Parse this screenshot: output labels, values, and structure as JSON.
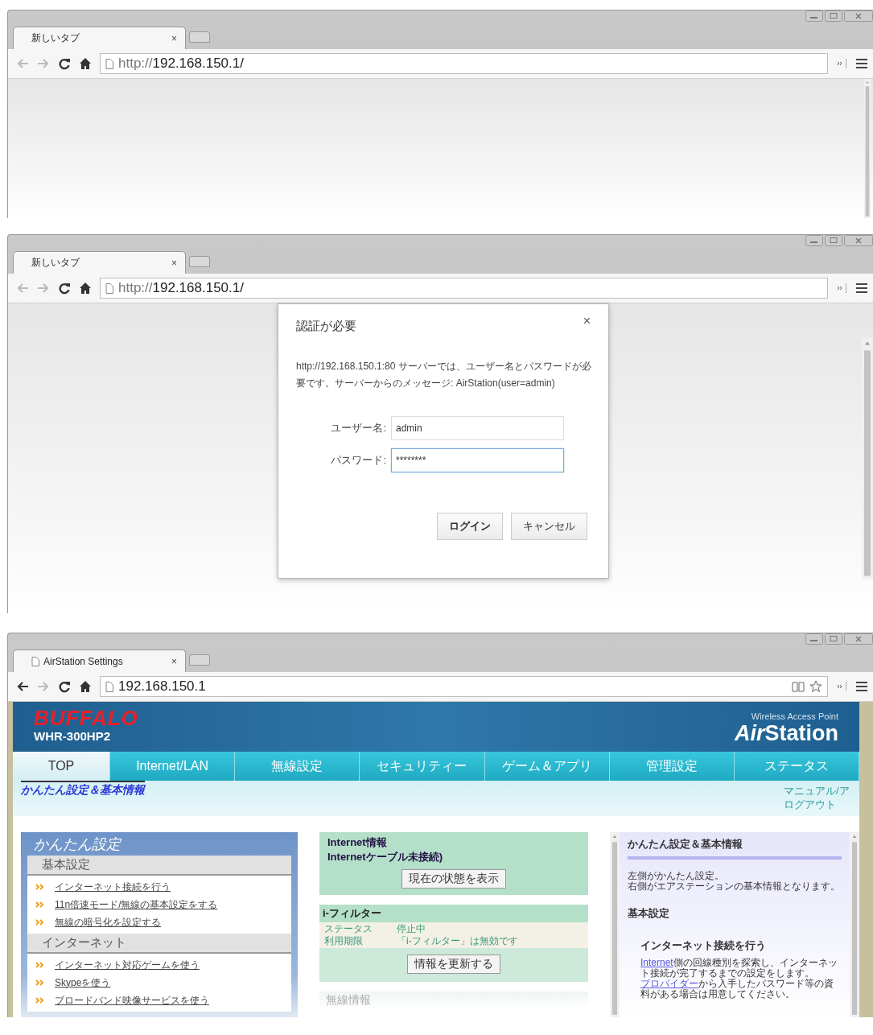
{
  "windows": [
    {
      "kind": "blank",
      "tab": {
        "title": "新しいタブ",
        "close": "×"
      },
      "url": "http://**192.168.150.1/**",
      "back_enabled": false
    },
    {
      "kind": "auth",
      "tab": {
        "title": "新しいタブ",
        "close": "×"
      },
      "url": "http://**192.168.150.1/**",
      "back_enabled": false,
      "dialog": {
        "title": "認証が必要",
        "close": "×",
        "message": "http://192.168.150.1:80 サーバーでは、ユーザー名とパスワードが必要です。サーバーからのメッセージ: AirStation(user=admin)",
        "fields": [
          {
            "label": "ユーザー名:",
            "value": "admin",
            "focused": false
          },
          {
            "label": "パスワード:",
            "value": "********",
            "focused": true
          }
        ],
        "buttons": [
          {
            "label": "ログイン",
            "kind": "primary"
          },
          {
            "label": "キャンセル",
            "kind": "secondary"
          }
        ]
      }
    },
    {
      "kind": "airstation",
      "tab": {
        "title": "AirStation Settings",
        "close": "×"
      },
      "url": "192.168.150.1",
      "back_enabled": true,
      "page": {
        "brand": "BUFFALO",
        "model": "WHR-300HP2",
        "product_caption": "Wireless Access Point",
        "product_name": [
          "Air",
          "Station"
        ],
        "nav": [
          {
            "label": "TOP",
            "selected": true
          },
          {
            "label": "Internet/LAN",
            "selected": false
          },
          {
            "label": "無線設定",
            "selected": false
          },
          {
            "label": "セキュリティー",
            "selected": false
          },
          {
            "label": "ゲーム＆アプリ",
            "selected": false
          },
          {
            "label": "管理設定",
            "selected": false
          },
          {
            "label": "ステータス",
            "selected": false
          }
        ],
        "breadcrumb": "かんたん設定＆基本情報",
        "header_links": [
          "マニュアル/ア",
          "ログアウト"
        ],
        "quick_setup": {
          "title": "かんたん設定",
          "sections": [
            {
              "title": "基本設定",
              "links": [
                "インターネット接続を行う",
                "11n倍速モード/無線の基本設定をする",
                "無線の暗号化を設定する"
              ]
            },
            {
              "title": "インターネット",
              "links": [
                "インターネット対応ゲームを使う",
                "Skypeを使う",
                "ブロードバンド映像サービスを使う"
              ]
            }
          ]
        },
        "internet_info": {
          "title": "Internet情報",
          "status": "Internetケーブル未接続)",
          "button": "現在の状態を表示"
        },
        "filter": {
          "title": "i-フィルター",
          "rows": [
            {
              "label": "ステータス",
              "value": "停止中"
            },
            {
              "label": "利用期限",
              "value": "「i-フィルター」は無効です"
            }
          ],
          "button": "情報を更新する"
        },
        "wireless_info": {
          "title": "無線情報"
        },
        "help": {
          "title": "かんたん設定＆基本情報",
          "intro": [
            "左側がかんたん設定。",
            "右側がエアステーションの基本情報となります。"
          ],
          "section": "基本設定",
          "topic": "インターネット接続を行う",
          "paragraphs": [
            {
              "link": "Internet",
              "text": "側の回線種別を探索し、インターネット接続が完了するまでの設定をします。"
            },
            {
              "link": "プロバイダー",
              "text": "から入手したパスワード等の資料がある場合は用意してください。"
            }
          ]
        }
      }
    }
  ]
}
